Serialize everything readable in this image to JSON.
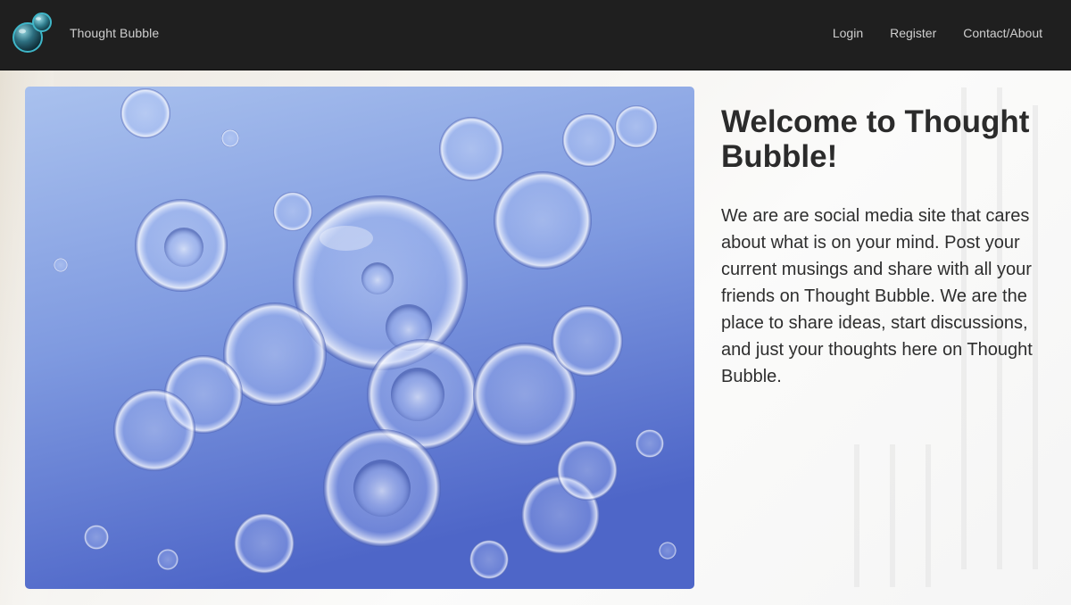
{
  "navbar": {
    "brand": "Thought Bubble",
    "links": [
      {
        "label": "Login"
      },
      {
        "label": "Register"
      },
      {
        "label": "Contact/About"
      }
    ]
  },
  "hero": {
    "image_description_icon": "bubbles-image"
  },
  "main": {
    "title": "Welcome to Thought Bubble!",
    "description": "We are are social media site that cares about what is on your mind. Post your current musings and share with all your friends on Thought Bubble. We are the place to share ideas, start discussions, and just your thoughts here on Thought Bubble."
  },
  "colors": {
    "navbar_bg": "#1f1f1f",
    "nav_text": "#cfcfcf",
    "accent_teal": "#3fb6c8",
    "heading": "#2b2b2b"
  }
}
